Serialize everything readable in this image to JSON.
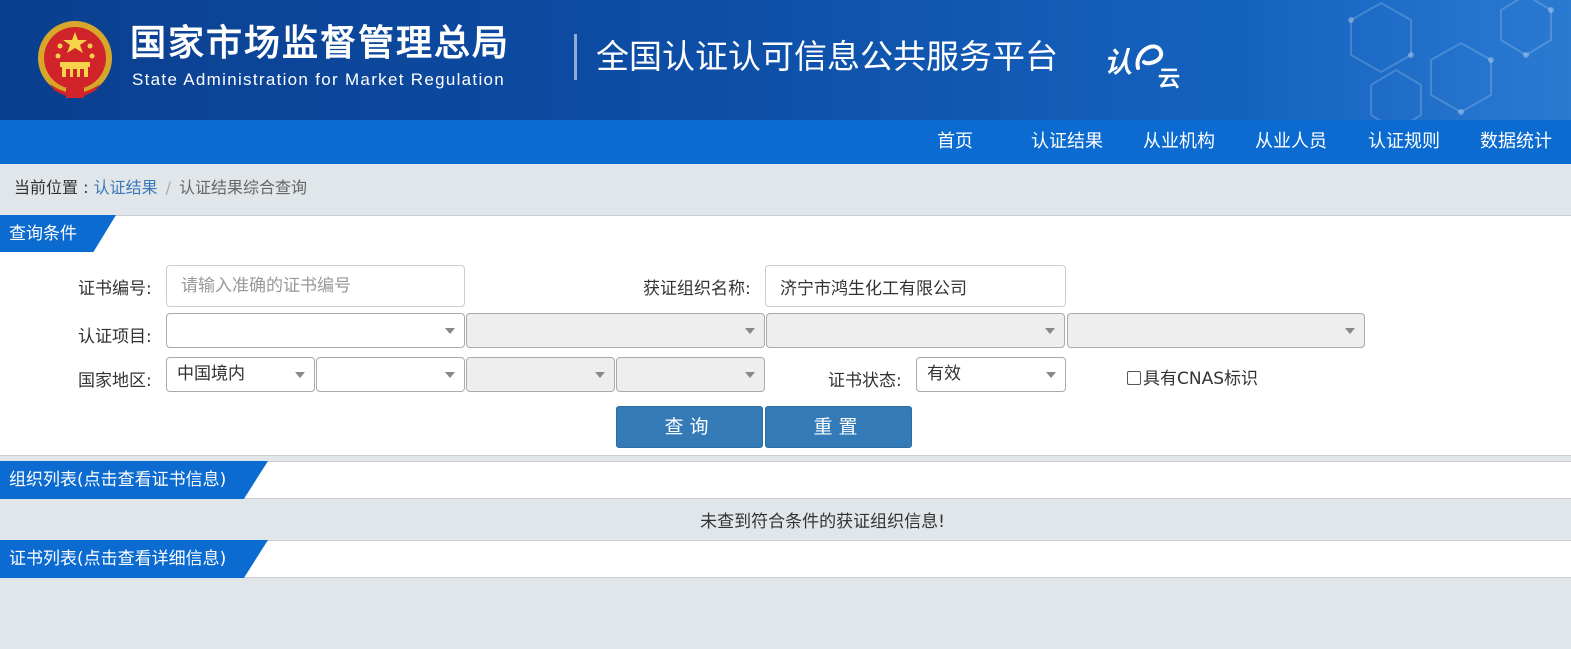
{
  "header": {
    "agency_cn": "国家市场监督管理总局",
    "agency_en": "State Administration  for  Market Regulation",
    "platform_title": "全国认证认可信息公共服务平台",
    "logo_text": "认e云",
    "brand_color": "#0c6bd0"
  },
  "nav": {
    "items": [
      {
        "label": "首页"
      },
      {
        "label": "认证结果"
      },
      {
        "label": "从业机构"
      },
      {
        "label": "从业人员"
      },
      {
        "label": "认证规则"
      },
      {
        "label": "数据统计"
      }
    ]
  },
  "breadcrumb": {
    "prefix": "当前位置 : ",
    "link": "认证结果",
    "separator": "/",
    "current": "认证结果综合查询"
  },
  "query": {
    "section_title": "查询条件",
    "cert_no_label": "证书编号:",
    "cert_no_placeholder": "请输入准确的证书编号",
    "cert_no_value": "",
    "org_name_label": "获证组织名称:",
    "org_name_value": "济宁市鸿生化工有限公司",
    "project_label": "认证项目:",
    "project_selects": [
      "",
      "",
      "",
      ""
    ],
    "region_label": "国家地区:",
    "region_selects": [
      "中国境内",
      "",
      "",
      ""
    ],
    "status_label": "证书状态:",
    "status_value": "有效",
    "cnas_label": "具有CNAS标识",
    "search_button": "查询",
    "reset_button": "重置"
  },
  "org_list": {
    "section_title": "组织列表(点击查看证书信息)",
    "empty_message": "未查到符合条件的获证组织信息!"
  },
  "cert_list": {
    "section_title": "证书列表(点击查看详细信息)"
  }
}
